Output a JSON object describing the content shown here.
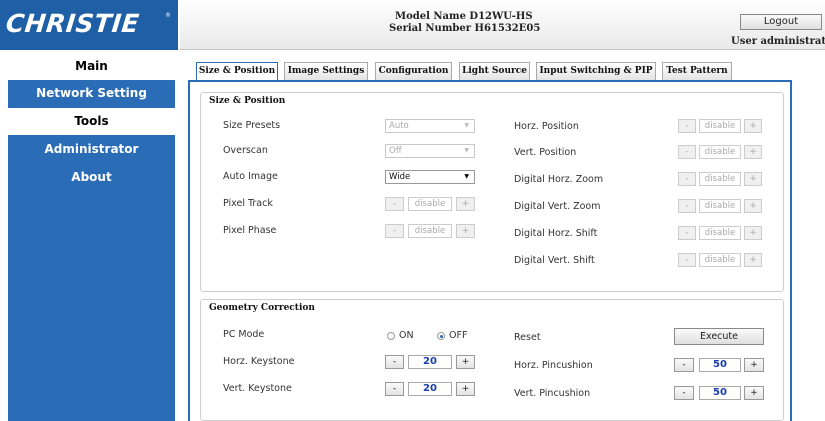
{
  "header": {
    "brand": "CHRISTIE",
    "model_name": "Model Name D12WU-HS",
    "serial_number": "Serial Number H61532E05",
    "logout_label": "Logout",
    "user_label": "User administrato"
  },
  "sidebar": {
    "items": [
      {
        "label": "Main"
      },
      {
        "label": "Network Setting"
      },
      {
        "label": "Tools"
      },
      {
        "label": "Administrator"
      },
      {
        "label": "About"
      }
    ]
  },
  "tabs": [
    {
      "label": "Size & Position",
      "active": true
    },
    {
      "label": "Image Settings"
    },
    {
      "label": "Configuration"
    },
    {
      "label": "Light Source"
    },
    {
      "label": "Input Switching & PIP"
    },
    {
      "label": "Test Pattern"
    }
  ],
  "size_position": {
    "title": "Size & Position",
    "size_presets": {
      "label": "Size Presets",
      "value": "Auto"
    },
    "overscan": {
      "label": "Overscan",
      "value": "Off"
    },
    "auto_image": {
      "label": "Auto Image",
      "value": "Wide"
    },
    "pixel_track": {
      "label": "Pixel Track",
      "value": "disable"
    },
    "pixel_phase": {
      "label": "Pixel Phase",
      "value": "disable"
    },
    "horz_position": {
      "label": "Horz. Position",
      "value": "disable"
    },
    "vert_position": {
      "label": "Vert. Position",
      "value": "disable"
    },
    "digital_horz_zoom": {
      "label": "Digital Horz. Zoom",
      "value": "disable"
    },
    "digital_vert_zoom": {
      "label": "Digital Vert. Zoom",
      "value": "disable"
    },
    "digital_horz_shift": {
      "label": "Digital Horz. Shift",
      "value": "disable"
    },
    "digital_vert_shift": {
      "label": "Digital Vert. Shift",
      "value": "disable"
    },
    "minus_label": "-",
    "plus_label": "+",
    "dropdown_arrow": "▼"
  },
  "geometry": {
    "title": "Geometry Correction",
    "pc_mode": {
      "label": "PC Mode",
      "on_label": "ON",
      "off_label": "OFF",
      "selected": "OFF"
    },
    "reset": {
      "label": "Reset",
      "button_label": "Execute"
    },
    "horz_keystone": {
      "label": "Horz. Keystone",
      "value": "20"
    },
    "vert_keystone": {
      "label": "Vert. Keystone",
      "value": "20"
    },
    "horz_pincushion": {
      "label": "Horz. Pincushion",
      "value": "50"
    },
    "vert_pincushion": {
      "label": "Vert. Pincushion",
      "value": "50"
    }
  },
  "colors": {
    "accent": "#2a6cb5",
    "value_text": "#1a3ea8"
  }
}
